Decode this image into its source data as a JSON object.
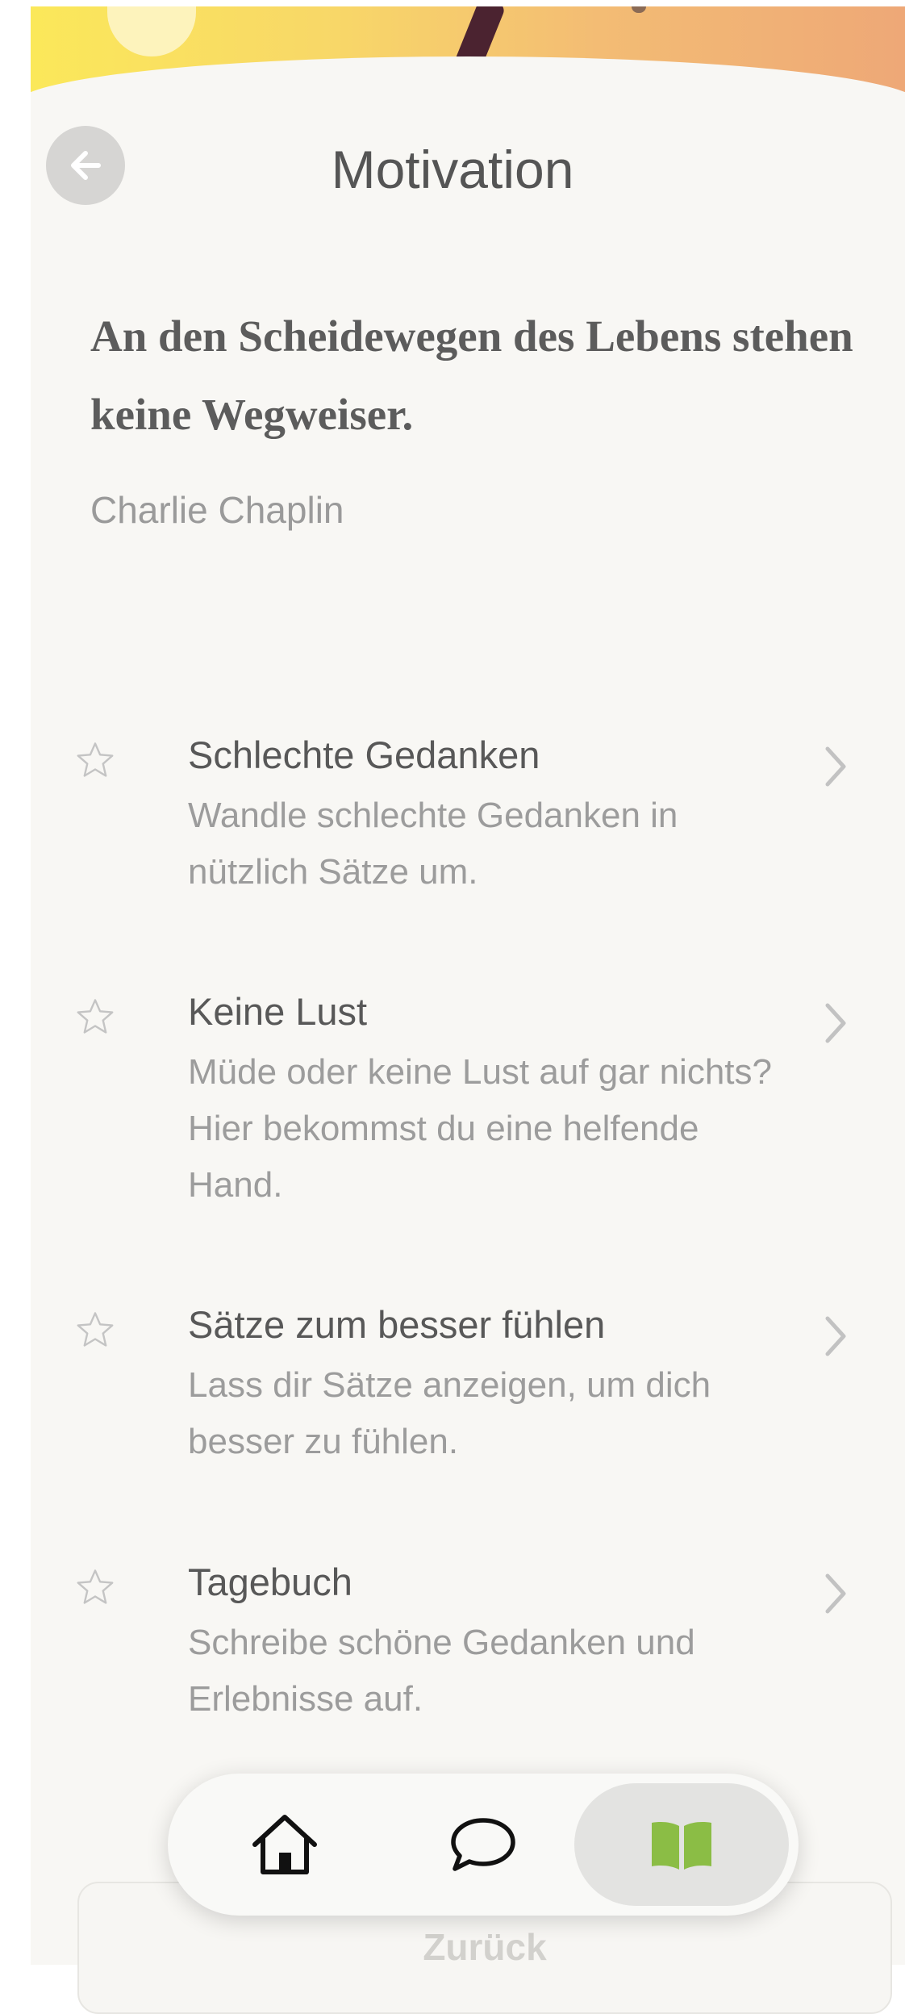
{
  "header": {
    "title": "Motivation",
    "back_icon": "arrow-left-icon"
  },
  "quote": {
    "text": "An den Scheidewegen des Lebens stehen keine Wegweiser.",
    "author": "Charlie Chaplin"
  },
  "items": [
    {
      "title": "Schlechte Gedanken",
      "description": "Wandle schlechte Gedanken in nützlich Sätze um.",
      "favorite": false
    },
    {
      "title": "Keine Lust",
      "description": "Müde oder keine Lust auf gar nichts? Hier bekommst du eine helfende Hand.",
      "favorite": false
    },
    {
      "title": "Sätze zum besser fühlen",
      "description": "Lass dir Sätze anzeigen, um dich besser zu fühlen.",
      "favorite": false
    },
    {
      "title": "Tagebuch",
      "description": "Schreibe schöne Gedanken und Erlebnisse auf.",
      "favorite": false
    }
  ],
  "back_button": {
    "label": "Zurück"
  },
  "tabbar": {
    "tabs": [
      {
        "icon": "home-icon",
        "active": false
      },
      {
        "icon": "chat-bubble-icon",
        "active": false
      },
      {
        "icon": "book-icon",
        "active": true
      }
    ]
  },
  "colors": {
    "background": "#f8f7f4",
    "text_primary": "#585858",
    "text_secondary": "#9c9c9c",
    "accent_green": "#8bbd45"
  }
}
